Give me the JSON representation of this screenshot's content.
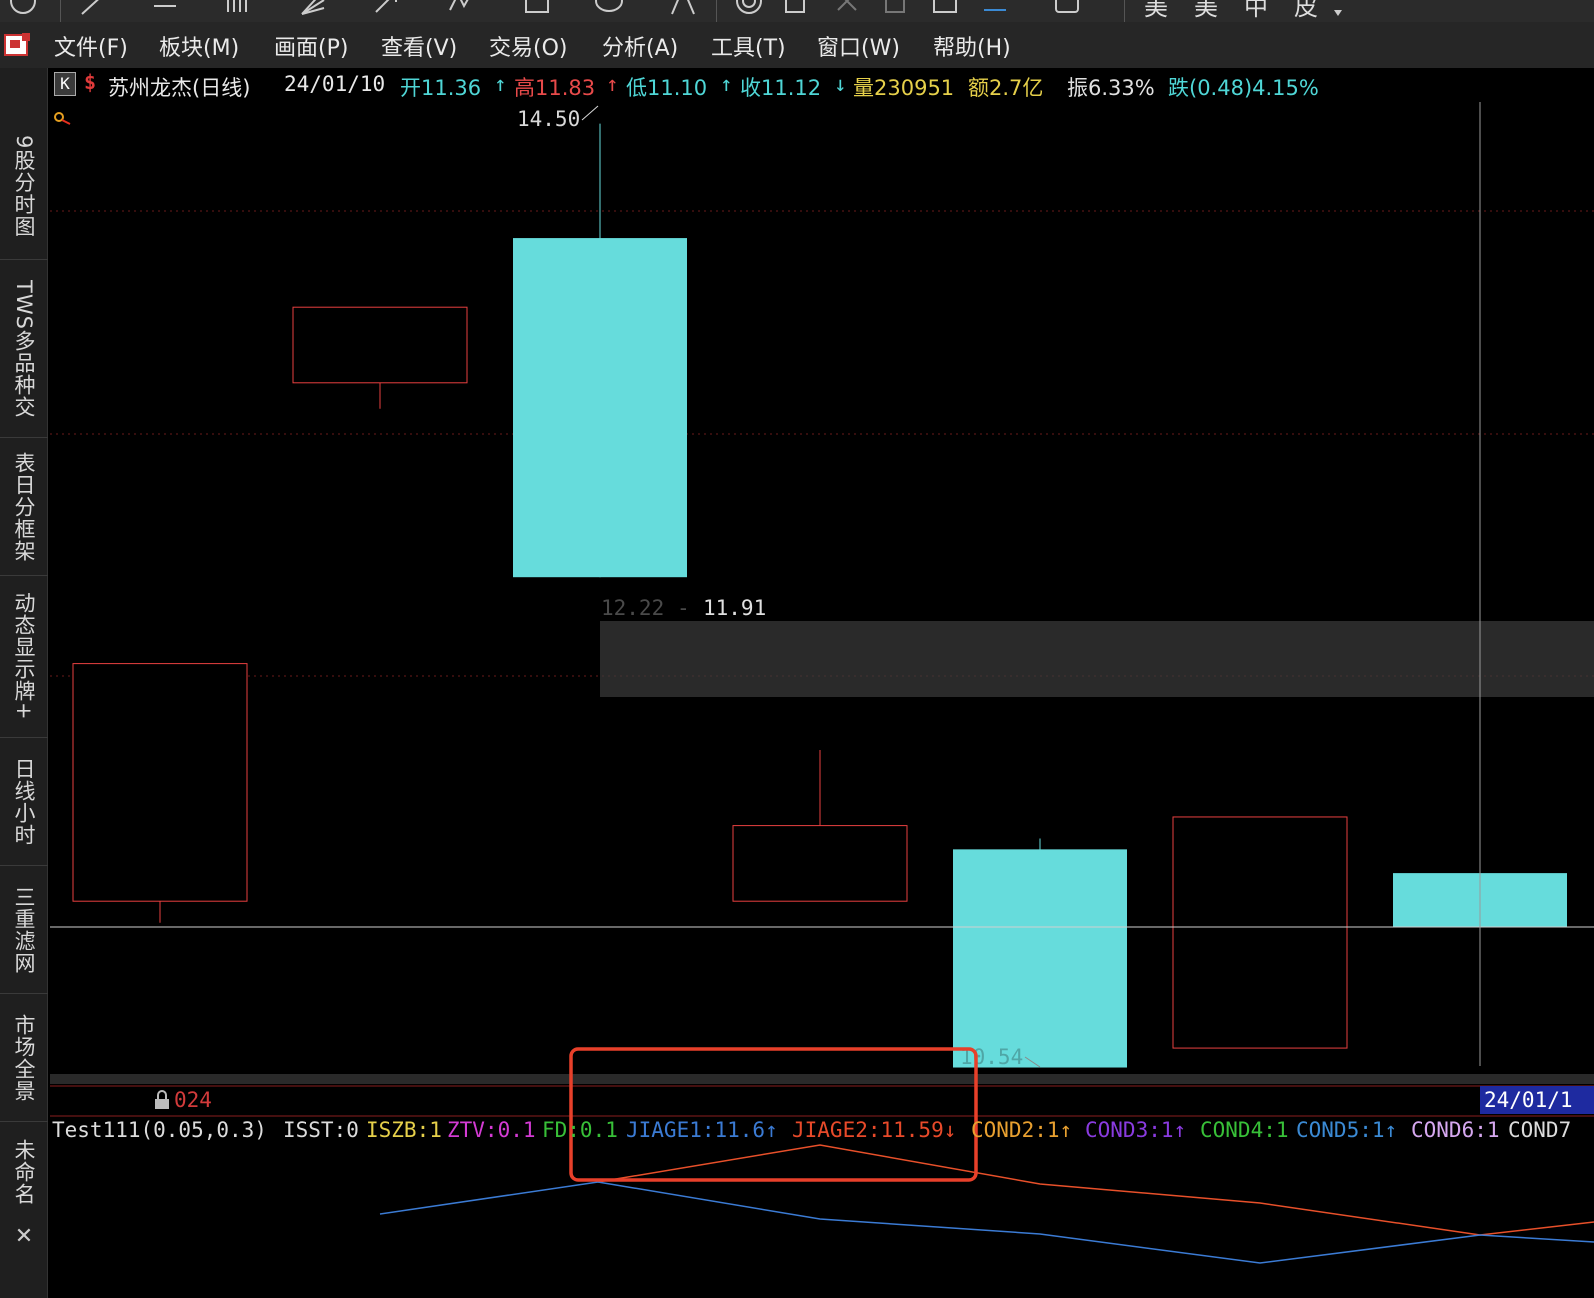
{
  "toolbar": {
    "tail_text": [
      "美",
      "美",
      "中",
      "皮"
    ]
  },
  "menu": {
    "items": [
      "文件(F)",
      "板块(M)",
      "画面(P)",
      "查看(V)",
      "交易(O)",
      "分析(A)",
      "工具(T)",
      "窗口(W)",
      "帮助(H)"
    ]
  },
  "sidebar": {
    "tabs": [
      "9股分时图",
      "TWS多品种交",
      "表日分框架",
      "动态显示牌+",
      "日线小时",
      "三重滤网",
      "市场全景",
      "未命名"
    ],
    "close_label": "✕"
  },
  "info": {
    "k_label": "K",
    "stock_name": "苏州龙杰(日线)",
    "date": "24/01/10",
    "open": "开11.36",
    "high": "高11.83",
    "low": "低11.10",
    "close": "收11.12",
    "volume": "量230951",
    "amount": "额2.7亿",
    "amplitude": "振6.33%",
    "change": "跌(0.48)4.15%",
    "colors": {
      "open": "#4fd6d6",
      "high": "#e84a4a",
      "low": "#4fd6d6",
      "close": "#4fd6d6",
      "volume": "#e6d04a",
      "amount": "#e6d04a",
      "amplitude": "#e0e0e0",
      "change": "#4fd6d6"
    }
  },
  "chart": {
    "label_high": "14.50",
    "label_mid_left": "12.22",
    "label_mid_right": "11.91",
    "label_low": "10.54",
    "year_fragment": "024",
    "date_box": "24/01/1"
  },
  "chart_data": {
    "type": "candlestick",
    "candles": [
      {
        "type": "up",
        "open": 10.9,
        "close": 12.0,
        "high": 12.0,
        "low": 10.8
      },
      {
        "type": "up",
        "open": 13.3,
        "close": 13.65,
        "high": 13.65,
        "low": 13.18
      },
      {
        "type": "down",
        "open": 13.97,
        "close": 12.4,
        "high": 14.5,
        "low": 12.4
      },
      {
        "type": "up",
        "open": 10.9,
        "close": 11.25,
        "high": 11.6,
        "low": 10.9
      },
      {
        "type": "down",
        "open": 11.14,
        "close": 10.13,
        "high": 11.19,
        "low": 10.13
      },
      {
        "type": "up",
        "open": 10.22,
        "close": 11.29,
        "high": 11.29,
        "low": 10.22
      },
      {
        "type": "down",
        "open": 11.03,
        "close": 10.78,
        "high": 11.36,
        "low": 10.67
      }
    ],
    "price_range": [
      10.1,
      14.6
    ]
  },
  "indicator": {
    "name": "Test111(0.05,0.3)",
    "isst": "ISST:0",
    "iszb": "ISZB:1",
    "ztv": "ZTV:0.1",
    "fd": "FD:0.1",
    "jiage1": "JIAGE1:11.6↑",
    "jiage2": "JIAGE2:11.59↓",
    "cond2": "COND2:1↑",
    "cond3": "COND3:1↑",
    "cond4": "COND4:1",
    "cond5": "COND5:1↑",
    "cond6": "COND6:1",
    "cond7": "COND7",
    "colors": {
      "name": "#dcdcdc",
      "isst": "#dcdcdc",
      "iszb": "#e6d04a",
      "ztv": "#d43bd4",
      "fd": "#38c038",
      "jiage1": "#3b7bd4",
      "jiage2": "#e84a2a",
      "cond2": "#e8a030",
      "cond3": "#8a3be0",
      "cond4": "#38c038",
      "cond5": "#3b8ad4",
      "cond6": "#d6a8f0",
      "cond7": "#dcdcdc"
    }
  }
}
